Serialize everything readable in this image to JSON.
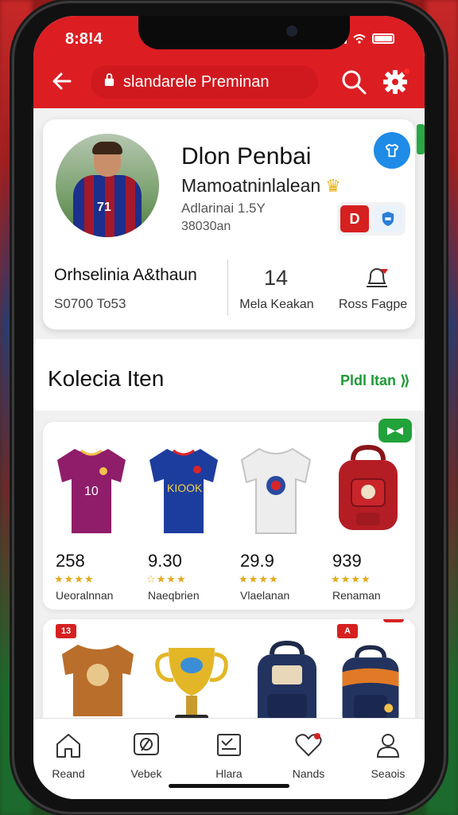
{
  "status": {
    "time": "8:8!4"
  },
  "header": {
    "address": "slandarele Preminan",
    "back_icon": "arrow-left-icon",
    "search_icon": "search-icon",
    "settings_icon": "gear-icon",
    "brand_color": "#dc1e23"
  },
  "profile": {
    "name": "Dlon Penbai",
    "subtitle": "Mamoatninlalean",
    "meta1": "Adlarinai 1.5Y",
    "meta2": "38030an",
    "badge_red": "D",
    "stats": {
      "left_title": "Orhselinia A&thaun",
      "left_value": "S0700 To53",
      "mid_value": "14",
      "mid_label": "Mela Keakan",
      "right_label": "Ross Fagpe"
    }
  },
  "section": {
    "title": "Kolecia Iten",
    "link": "Pldl Itan ⟫"
  },
  "grid": {
    "toggle": "▶◀",
    "items": [
      {
        "price": "258",
        "stars": "★★★★",
        "caption": "Ueoralnnan",
        "icon": "purple-jersey"
      },
      {
        "price": "9.30",
        "stars": "☆★★★",
        "caption": "Naeqbrien",
        "icon": "blue-jersey"
      },
      {
        "price": "29.9",
        "stars": "★★★★",
        "caption": "Vlaelanan",
        "icon": "white-jersey"
      },
      {
        "price": "939",
        "stars": "★★★★",
        "caption": "Renaman",
        "icon": "red-backpack"
      }
    ],
    "tag1": "13",
    "tag2": "A"
  },
  "bottom_nav": [
    {
      "label": "Reand",
      "icon": "home-icon"
    },
    {
      "label": "Vebek",
      "icon": "chat-icon"
    },
    {
      "label": "Hlara",
      "icon": "list-icon"
    },
    {
      "label": "Nands",
      "icon": "heart-icon"
    },
    {
      "label": "Seaois",
      "icon": "user-icon"
    }
  ]
}
